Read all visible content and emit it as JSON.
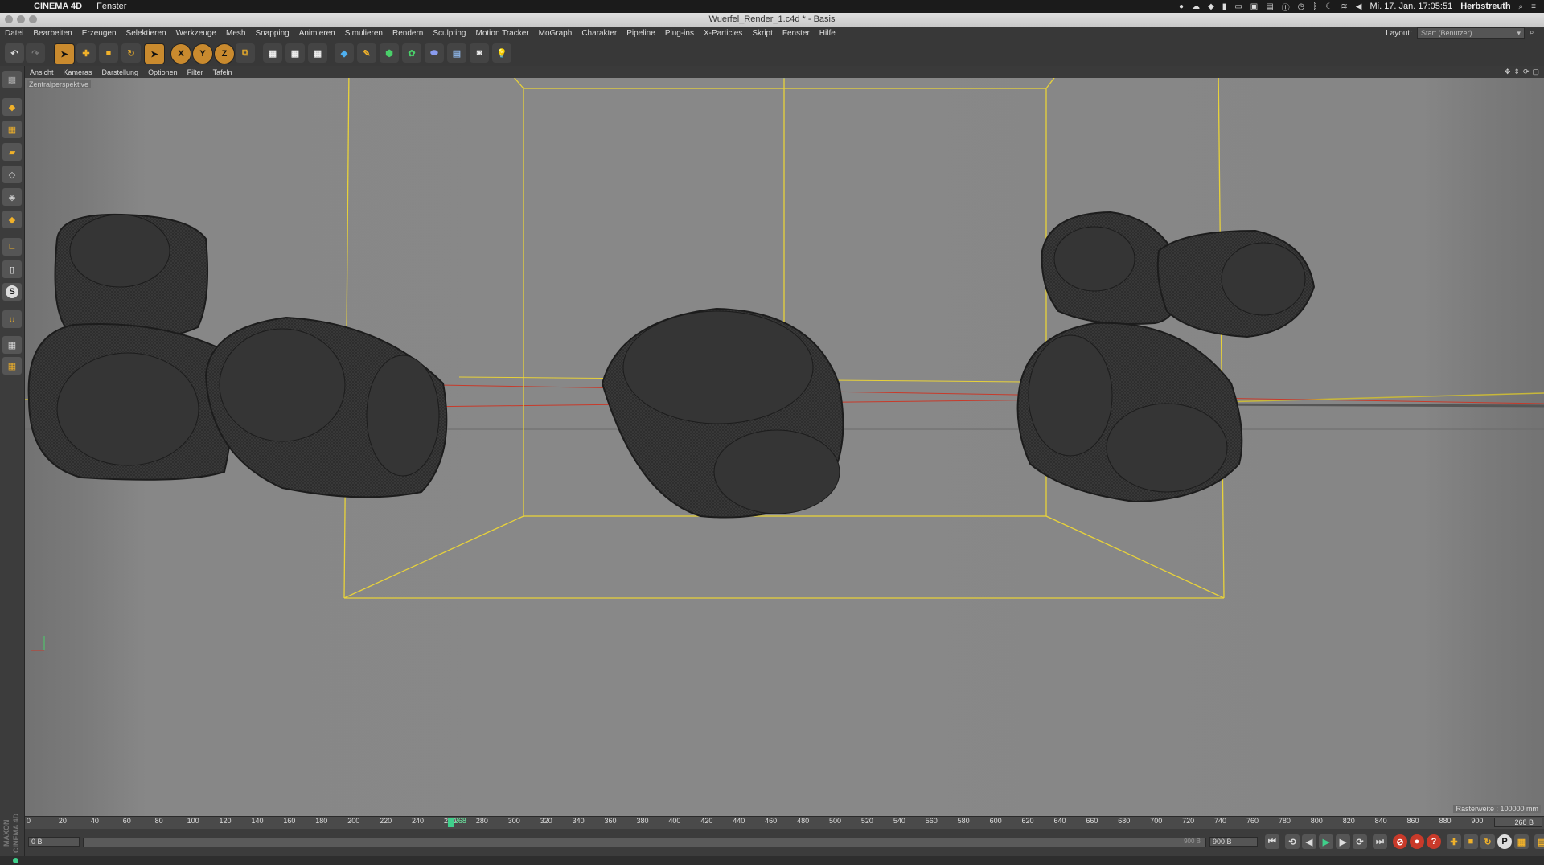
{
  "mac_menubar": {
    "app_name": "CINEMA 4D",
    "menu": [
      "Fenster"
    ],
    "clock": "Mi. 17. Jan.  17:05:51",
    "user": "Herbstreuth"
  },
  "window": {
    "title": "Wuerfel_Render_1.c4d * - Basis"
  },
  "main_menu": {
    "items": [
      "Datei",
      "Bearbeiten",
      "Erzeugen",
      "Selektieren",
      "Werkzeuge",
      "Mesh",
      "Snapping",
      "Animieren",
      "Simulieren",
      "Rendern",
      "Sculpting",
      "Motion Tracker",
      "MoGraph",
      "Charakter",
      "Pipeline",
      "Plug-ins",
      "X-Particles",
      "Skript",
      "Fenster",
      "Hilfe"
    ],
    "layout_label": "Layout:",
    "layout_value": "Start (Benutzer)"
  },
  "toolbar": {
    "axis_x": "X",
    "axis_y": "Y",
    "axis_z": "Z"
  },
  "left_toolbar": {
    "s_label": "S"
  },
  "viewport_menu": {
    "items": [
      "Ansicht",
      "Kameras",
      "Darstellung",
      "Optionen",
      "Filter",
      "Tafeln"
    ]
  },
  "viewport": {
    "perspective_label": "Zentralperspektive",
    "grid_label": "Rasterweite : 100000 mm"
  },
  "timeline": {
    "ticks": [
      0,
      20,
      40,
      60,
      80,
      100,
      120,
      140,
      160,
      180,
      200,
      220,
      240,
      260,
      280,
      300,
      320,
      340,
      360,
      380,
      400,
      420,
      440,
      460,
      480,
      500,
      520,
      540,
      560,
      580,
      600,
      620,
      640,
      660,
      680,
      700,
      720,
      740,
      760,
      780,
      800,
      820,
      840,
      860,
      880,
      900
    ],
    "playhead_frame": 268,
    "playhead_label": "268",
    "end_field": "268 B"
  },
  "transport": {
    "start_field": "0 B",
    "range_end_label": "900 B",
    "end_field": "900 B",
    "p_label": "P"
  },
  "colors": {
    "accent_green": "#3fd08b",
    "bounding_box": "#e8d23a",
    "red_line": "#c83a2a"
  }
}
